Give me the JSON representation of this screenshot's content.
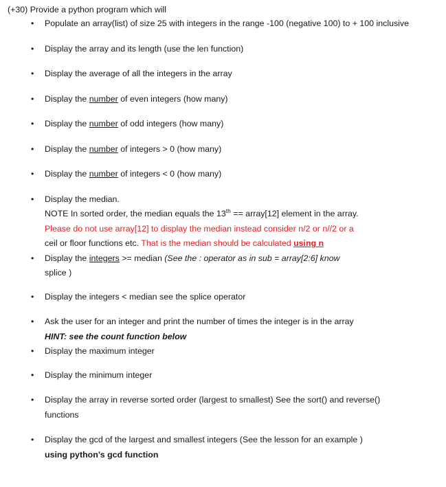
{
  "document": {
    "heading": "(+30) Provide a python program which will",
    "bullet_glyph": "•",
    "accent_red": "#eb1c23",
    "text_color": "#1a1a1a",
    "background": "#ffffff"
  },
  "items": [
    {
      "id": "populate-array",
      "text": "Populate an array(list) of size 25 with integers in the range -100 (negative 100)  to + 100 inclusive"
    },
    {
      "id": "display-array-length",
      "text": "Display the array and its length (use the len function)"
    },
    {
      "id": "display-average",
      "text": "Display the average of all the integers in the array"
    },
    {
      "id": "display-even-count",
      "prefix": "Display the ",
      "underlined": "number",
      "suffix": " of even integers  (how many)"
    },
    {
      "id": "display-odd-count",
      "prefix": "Display the ",
      "underlined": "number",
      "suffix": " of odd integers  (how many)"
    },
    {
      "id": "display-positive-count",
      "prefix": "Display the ",
      "underlined": "number",
      "suffix": " of integers > 0   (how many)"
    },
    {
      "id": "display-negative-count",
      "prefix": "Display the ",
      "underlined": "number",
      "suffix": " of integers < 0   (how many)"
    },
    {
      "id": "display-median",
      "text": "Display the median.",
      "note_prefix": "NOTE  In sorted order, the median equals the 13",
      "note_sup": "th",
      "note_suffix": " == array[12] element in the array.",
      "warn_red_line1": "Please do not use array[12] to display the median instead consider n/2 or n//2 or a",
      "warn_black_line2": "ceil or floor functions  etc.  ",
      "warn_red_line2": "That is the median should be calculated ",
      "warn_red_bold_underline": "using  n"
    },
    {
      "id": "display-ge-median",
      "prefix": "Display the ",
      "underlined": "integers",
      "suffix": " >= median   ",
      "italic": "(See the : operator as in sub = array[2:6]  know",
      "second_line": "splice  )"
    },
    {
      "id": "display-lt-median",
      "text": "Display the integers  <  median see the splice operator"
    },
    {
      "id": "count-occurrences",
      "text": "Ask the user for an integer and print the number of times the integer is in the array",
      "hint": "HINT: see the count function below"
    },
    {
      "id": "display-maximum",
      "text": " Display the maximum integer"
    },
    {
      "id": "display-minimum",
      "text": "Display the minimum integer"
    },
    {
      "id": "display-reverse-sorted",
      "text": "Display the array in reverse sorted order (largest to smallest) See the sort() and reverse() functions"
    },
    {
      "id": "display-gcd",
      "text": "Display the gcd of the largest and smallest integers  (See the lesson for an example )",
      "bold_line": "using python’s gcd function"
    }
  ]
}
